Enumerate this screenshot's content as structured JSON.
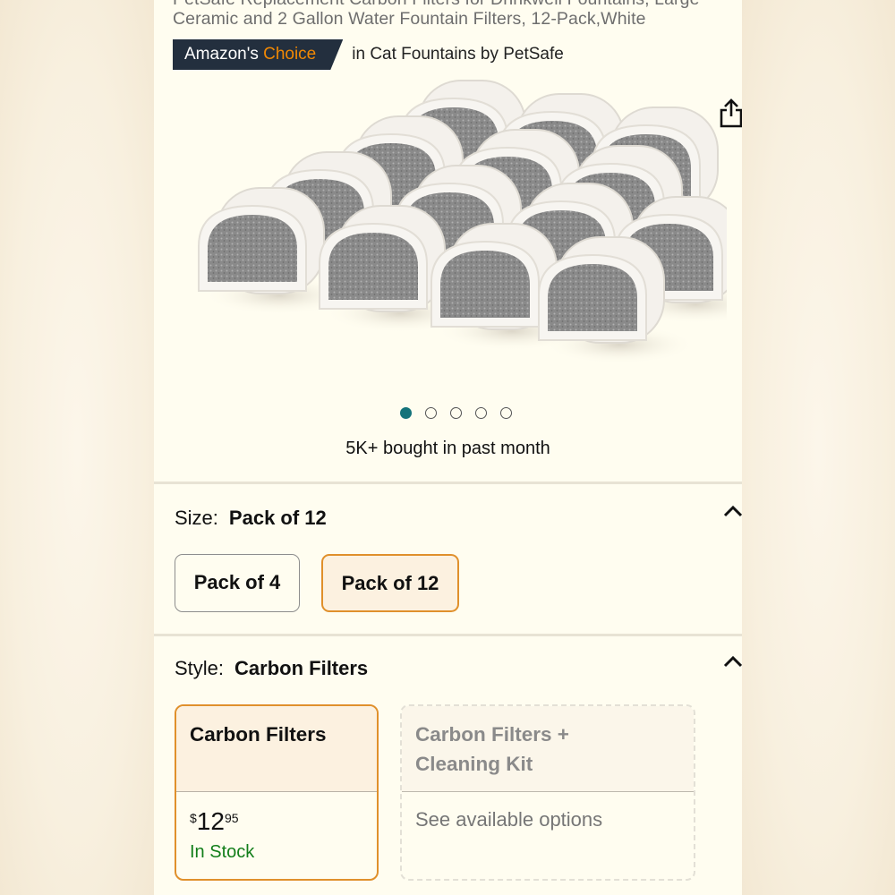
{
  "product": {
    "title_line_1": "PetSafe Replacement Carbon Filters for Drinkwell Fountains, Large",
    "title_line_2": "Ceramic and 2 Gallon Water Fountain Filters, 12-Pack,White"
  },
  "badge": {
    "label_main": "Amazon's",
    "label_accent": "Choice",
    "context": "in Cat Fountains by PetSafe"
  },
  "carousel": {
    "image_count": 5,
    "active_index": 0
  },
  "social_proof": "5K+ bought in past month",
  "size": {
    "label": "Size:",
    "selected": "Pack of 12",
    "options": [
      "Pack of 4",
      "Pack of 12"
    ]
  },
  "style": {
    "label": "Style:",
    "selected": "Carbon Filters",
    "options": [
      {
        "name": "Carbon Filters",
        "price_symbol": "$",
        "price_whole": "12",
        "price_fraction": "95",
        "availability": "In Stock"
      },
      {
        "name_line_1": "Carbon Filters +",
        "name_line_2": "Cleaning Kit",
        "note": "See available options"
      }
    ]
  },
  "colors": {
    "accent": "#f08804",
    "badge_bg": "#232f3e",
    "selected_border": "#e0902c",
    "in_stock": "#127e1a",
    "active_dot": "#14737a"
  },
  "icons": {
    "share": "share-icon",
    "collapse": "chevron-up-icon"
  }
}
